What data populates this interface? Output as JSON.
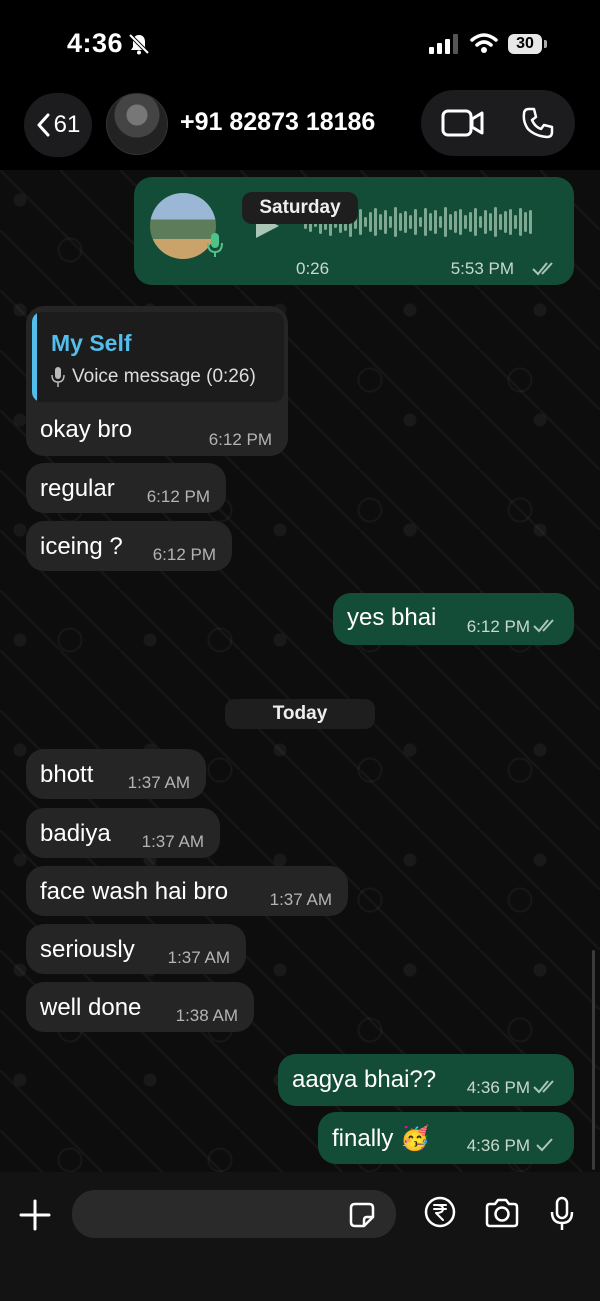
{
  "status_bar": {
    "time": "4:36",
    "battery": "30"
  },
  "header": {
    "back_count": "61",
    "contact_name": "+91 82873 18186"
  },
  "voice_message": {
    "duration": "0:26",
    "time": "5:53 PM"
  },
  "date_separators": {
    "saturday": "Saturday",
    "today": "Today"
  },
  "reply": {
    "sender": "My Self",
    "preview": "Voice message (0:26)"
  },
  "messages": [
    {
      "text": "okay bro",
      "time": "6:12 PM",
      "direction": "incoming"
    },
    {
      "text": "regular",
      "time": "6:12 PM",
      "direction": "incoming"
    },
    {
      "text": "iceing ?",
      "time": "6:12 PM",
      "direction": "incoming"
    },
    {
      "text": "yes bhai",
      "time": "6:12 PM",
      "direction": "outgoing",
      "status": "read"
    },
    {
      "text": "bhott",
      "time": "1:37 AM",
      "direction": "incoming"
    },
    {
      "text": "badiya",
      "time": "1:37 AM",
      "direction": "incoming"
    },
    {
      "text": "face wash hai bro",
      "time": "1:37 AM",
      "direction": "incoming"
    },
    {
      "text": "seriously",
      "time": "1:37 AM",
      "direction": "incoming"
    },
    {
      "text": "well done",
      "time": "1:38 AM",
      "direction": "incoming"
    },
    {
      "text": "aagya bhai??",
      "time": "4:36 PM",
      "direction": "outgoing",
      "status": "read"
    },
    {
      "text": "finally 🥳",
      "time": "4:36 PM",
      "direction": "outgoing",
      "status": "sent"
    }
  ],
  "composer": {
    "placeholder": ""
  },
  "colors": {
    "outgoing_bubble": "#144d37",
    "incoming_bubble": "#252525",
    "reply_accent": "#53bdeb"
  },
  "icons": [
    "bell-slash-icon",
    "signal-icon",
    "wifi-icon",
    "chevron-left-icon",
    "video-call-icon",
    "phone-icon",
    "play-icon",
    "microphone-icon",
    "plus-icon",
    "sticker-icon",
    "rupee-icon",
    "camera-icon"
  ]
}
